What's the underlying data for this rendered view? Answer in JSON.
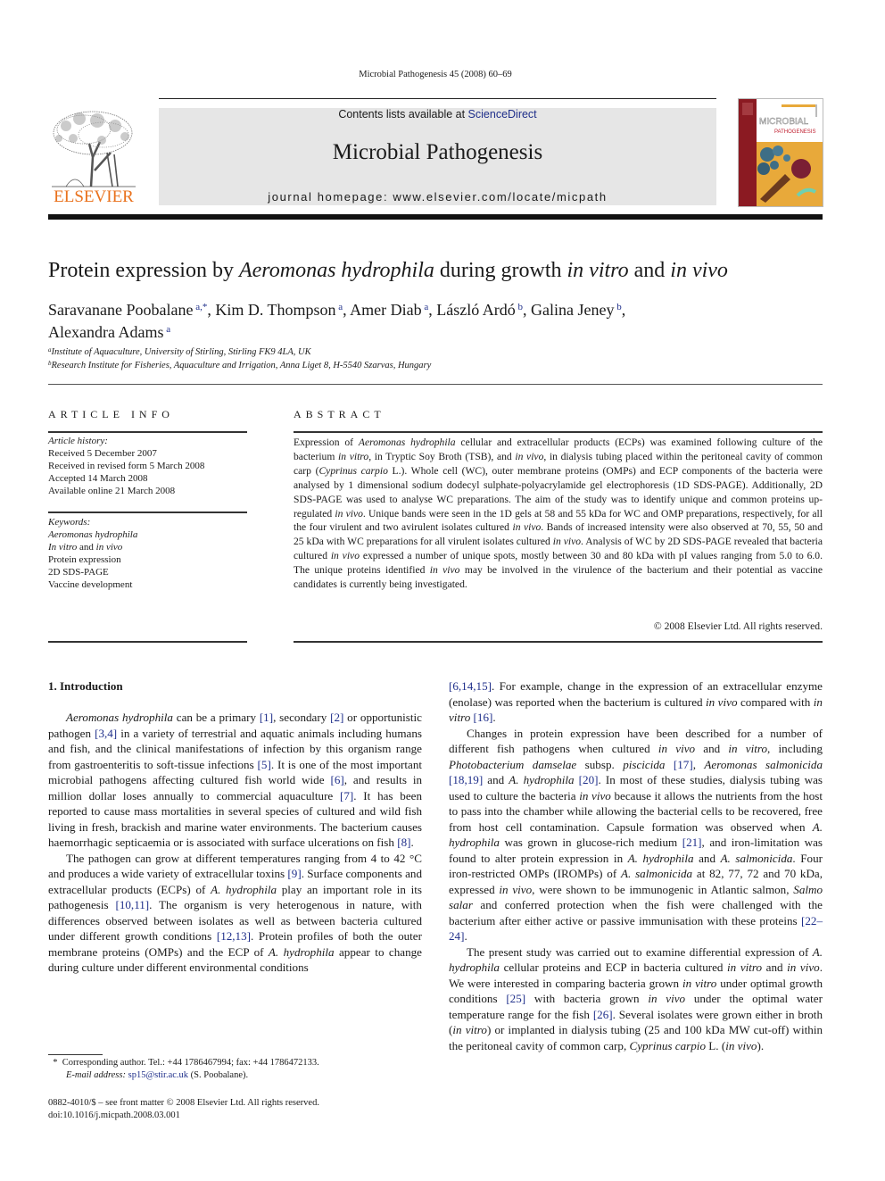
{
  "running_head": "Microbial Pathogenesis 45 (2008) 60–69",
  "header": {
    "contents_prefix": "Contents lists available at ",
    "contents_link": "ScienceDirect",
    "journal_title": "Microbial Pathogenesis",
    "homepage": "journal homepage: www.elsevier.com/locate/micpath",
    "publisher_logo_text": "ELSEVIER",
    "cover_title_1": "MICROBIAL",
    "cover_title_2": "PATHOGENESIS"
  },
  "colors": {
    "link": "#1f2f8a",
    "elsevier_orange": "#e9711c",
    "header_band": "#e6e6e6",
    "cover_red": "#8b1a22",
    "cover_yellow": "#e8a93a"
  },
  "article": {
    "title_parts": [
      {
        "text": "Protein expression by ",
        "italic": false
      },
      {
        "text": "Aeromonas hydrophila",
        "italic": true
      },
      {
        "text": " during growth ",
        "italic": false
      },
      {
        "text": "in vitro",
        "italic": true
      },
      {
        "text": " and ",
        "italic": false
      },
      {
        "text": "in vivo",
        "italic": true
      }
    ],
    "authors": [
      {
        "name": "Saravanane Poobalane",
        "sup": "a,*"
      },
      {
        "name": "Kim D. Thompson",
        "sup": "a"
      },
      {
        "name": "Amer Diab",
        "sup": "a"
      },
      {
        "name": "László Ardó",
        "sup": "b"
      },
      {
        "name": "Galina Jeney",
        "sup": "b"
      },
      {
        "name": "Alexandra Adams",
        "sup": "a"
      }
    ],
    "affiliations": [
      {
        "mark": "a",
        "text": "Institute of Aquaculture, University of Stirling, Stirling FK9 4LA, UK"
      },
      {
        "mark": "b",
        "text": "Research Institute for Fisheries, Aquaculture and Irrigation, Anna Liget 8, H-5540 Szarvas, Hungary"
      }
    ]
  },
  "article_info": {
    "heading": "ARTICLE INFO",
    "history_label": "Article history:",
    "history": [
      "Received 5 December 2007",
      "Received in revised form 5 March 2008",
      "Accepted 14 March 2008",
      "Available online 21 March 2008"
    ],
    "keywords_label": "Keywords:",
    "keywords": [
      {
        "text": "Aeromonas hydrophila",
        "italic": true
      },
      {
        "text": "In vitro and in vivo",
        "html": "<i>In vitro</i> and <i>in vivo</i>"
      },
      {
        "text": "Protein expression",
        "italic": false
      },
      {
        "text": "2D SDS-PAGE",
        "italic": false
      },
      {
        "text": "Vaccine development",
        "italic": false
      }
    ]
  },
  "abstract": {
    "heading": "ABSTRACT",
    "html": "Expression of <i>Aeromonas hydrophila</i> cellular and extracellular products (ECPs) was examined following culture of the bacterium <i>in vitro</i>, in Tryptic Soy Broth (TSB), and <i>in vivo</i>, in dialysis tubing placed within the peritoneal cavity of common carp (<i>Cyprinus carpio</i> L.). Whole cell (WC), outer membrane proteins (OMPs) and ECP components of the bacteria were analysed by 1 dimensional sodium dodecyl sulphate-polyacrylamide gel electrophoresis (1D SDS-PAGE). Additionally, 2D SDS-PAGE was used to analyse WC preparations. The aim of the study was to identify unique and common proteins up-regulated <i>in vivo</i>. Unique bands were seen in the 1D gels at 58 and 55 kDa for WC and OMP preparations, respectively, for all the four virulent and two avirulent isolates cultured <i>in vivo</i>. Bands of increased intensity were also observed at 70, 55, 50 and 25 kDa with WC preparations for all virulent isolates cultured <i>in vivo</i>. Analysis of WC by 2D SDS-PAGE revealed that bacteria cultured <i>in vivo</i> expressed a number of unique spots, mostly between 30 and 80 kDa with pI values ranging from 5.0 to 6.0. The unique proteins identified <i>in vivo</i> may be involved in the virulence of the bacterium and their potential as vaccine candidates is currently being investigated.",
    "copyright": "© 2008 Elsevier Ltd. All rights reserved."
  },
  "introduction": {
    "heading": "1.  Introduction",
    "left_paragraphs": [
      "<i>Aeromonas hydrophila</i> can be a primary <a data-cite>[1]</a>, secondary <a>[2]</a> or opportunistic pathogen <a>[3,4]</a> in a variety of terrestrial and aquatic animals including humans and fish, and the clinical manifestations of infection by this organism range from gastroenteritis to soft-tissue infections <a>[5]</a>. It is one of the most important microbial pathogens affecting cultured fish world wide <a>[6]</a>, and results in million dollar loses annually to commercial aquaculture <a>[7]</a>. It has been reported to cause mass mortalities in several species of cultured and wild fish living in fresh, brackish and marine water environments. The bacterium causes haemorrhagic septicaemia or is associated with surface ulcerations on fish <a>[8]</a>.",
      "The pathogen can grow at different temperatures ranging from 4 to 42 °C and produces a wide variety of extracellular toxins <a>[9]</a>. Surface components and extracellular products (ECPs) of <i>A. hydrophila</i> play an important role in its pathogenesis <a>[10,11]</a>. The organism is very heterogenous in nature, with differences observed between isolates as well as between bacteria cultured under different growth conditions <a>[12,13]</a>. Protein profiles of both the outer membrane proteins (OMPs) and the ECP of <i>A. hydrophila</i> appear to change during culture under different environmental conditions"
    ],
    "right_paragraphs": [
      "<a>[6,14,15]</a>. For example, change in the expression of an extracellular enzyme (enolase) was reported when the bacterium is cultured <i>in vivo</i> compared with <i>in vitro</i> <a>[16]</a>.",
      "Changes in protein expression have been described for a number of different fish pathogens when cultured <i>in vivo</i> and <i>in vitro</i>, including <i>Photobacterium damselae</i> subsp. <i>piscicida</i> <a>[17]</a>, <i>Aeromonas salmonicida</i> <a>[18,19]</a> and <i>A. hydrophila</i> <a>[20]</a>. In most of these studies, dialysis tubing was used to culture the bacteria <i>in vivo</i> because it allows the nutrients from the host to pass into the chamber while allowing the bacterial cells to be recovered, free from host cell contamination. Capsule formation was observed when <i>A. hydrophila</i> was grown in glucose-rich medium <a>[21]</a>, and iron-limitation was found to alter protein expression in <i>A. hydrophila</i> and <i>A. salmonicida</i>. Four iron-restricted OMPs (IROMPs) of <i>A. salmonicida</i> at 82, 77, 72 and 70 kDa, expressed <i>in vivo</i>, were shown to be immunogenic in Atlantic salmon, <i>Salmo salar</i> and conferred protection when the fish were challenged with the bacterium after either active or passive immunisation with these proteins <a>[22–24]</a>.",
      "The present study was carried out to examine differential expression of <i>A. hydrophila</i> cellular proteins and ECP in bacteria cultured <i>in vitro</i> and <i>in vivo</i>. We were interested in comparing bacteria grown <i>in vitro</i> under optimal growth conditions <a>[25]</a> with bacteria grown <i>in vivo</i> under the optimal water temperature range for the fish <a>[26]</a>. Several isolates were grown either in broth (<i>in vitro</i>) or implanted in dialysis tubing (25 and 100 kDa MW cut-off) within the peritoneal cavity of common carp, <i>Cyprinus carpio</i> L. (<i>in vivo</i>)."
    ]
  },
  "footnote": {
    "star": "*",
    "corresponding": "Corresponding author. Tel.: +44 1786467994; fax: +44 1786472133.",
    "email_label": "E-mail address:",
    "email": "sp15@stir.ac.uk",
    "email_suffix": " (S. Poobalane)."
  },
  "front_matter": {
    "issn_line": "0882-4010/$ – see front matter © 2008 Elsevier Ltd. All rights reserved.",
    "doi": "doi:10.1016/j.micpath.2008.03.001"
  }
}
